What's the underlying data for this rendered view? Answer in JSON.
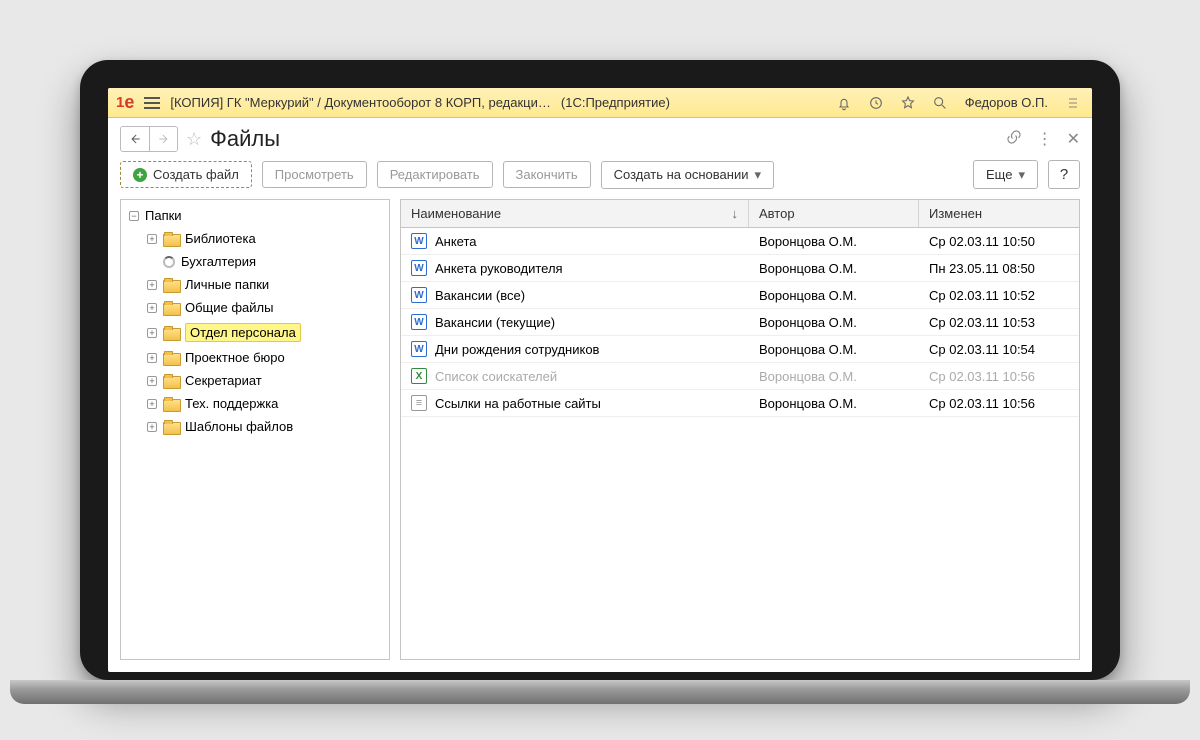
{
  "titlebar": {
    "app_title": "[КОПИЯ] ГК \"Меркурий\" / Документооборот 8 КОРП, редакци…",
    "mode": "(1С:Предприятие)",
    "user": "Федоров О.П."
  },
  "page": {
    "title": "Файлы"
  },
  "toolbar": {
    "create": "Создать файл",
    "view": "Просмотреть",
    "edit": "Редактировать",
    "finish": "Закончить",
    "createFrom": "Создать на основании",
    "more": "Еще",
    "help": "?"
  },
  "tree": {
    "root": "Папки",
    "items": [
      {
        "label": "Библиотека",
        "expander": "plus",
        "icon": "folder"
      },
      {
        "label": "Бухгалтерия",
        "expander": "blank",
        "icon": "loading"
      },
      {
        "label": "Личные папки",
        "expander": "plus",
        "icon": "folder"
      },
      {
        "label": "Общие файлы",
        "expander": "plus",
        "icon": "folder"
      },
      {
        "label": "Отдел персонала",
        "expander": "plus",
        "icon": "folder",
        "selected": true
      },
      {
        "label": "Проектное бюро",
        "expander": "plus",
        "icon": "folder"
      },
      {
        "label": "Секретариат",
        "expander": "plus",
        "icon": "folder"
      },
      {
        "label": "Тех. поддержка",
        "expander": "plus",
        "icon": "folder"
      },
      {
        "label": "Шаблоны файлов",
        "expander": "plus",
        "icon": "folder"
      }
    ]
  },
  "grid": {
    "headers": {
      "name": "Наименование",
      "author": "Автор",
      "changed": "Изменен"
    },
    "rows": [
      {
        "icon": "word",
        "name": "Анкета",
        "author": "Воронцова О.М.",
        "changed": "Ср 02.03.11 10:50"
      },
      {
        "icon": "word",
        "name": "Анкета руководителя",
        "author": "Воронцова О.М.",
        "changed": "Пн 23.05.11 08:50"
      },
      {
        "icon": "word",
        "name": "Вакансии (все)",
        "author": "Воронцова О.М.",
        "changed": "Ср 02.03.11 10:52"
      },
      {
        "icon": "word",
        "name": "Вакансии (текущие)",
        "author": "Воронцова О.М.",
        "changed": "Ср 02.03.11 10:53"
      },
      {
        "icon": "word",
        "name": "Дни рождения сотрудников",
        "author": "Воронцова О.М.",
        "changed": "Ср 02.03.11 10:54"
      },
      {
        "icon": "excel",
        "name": "Список соискателей",
        "author": "Воронцова О.М.",
        "changed": "Ср 02.03.11 10:56",
        "dim": true
      },
      {
        "icon": "text",
        "name": "Ссылки на работные сайты",
        "author": "Воронцова О.М.",
        "changed": "Ср 02.03.11 10:56"
      }
    ]
  }
}
